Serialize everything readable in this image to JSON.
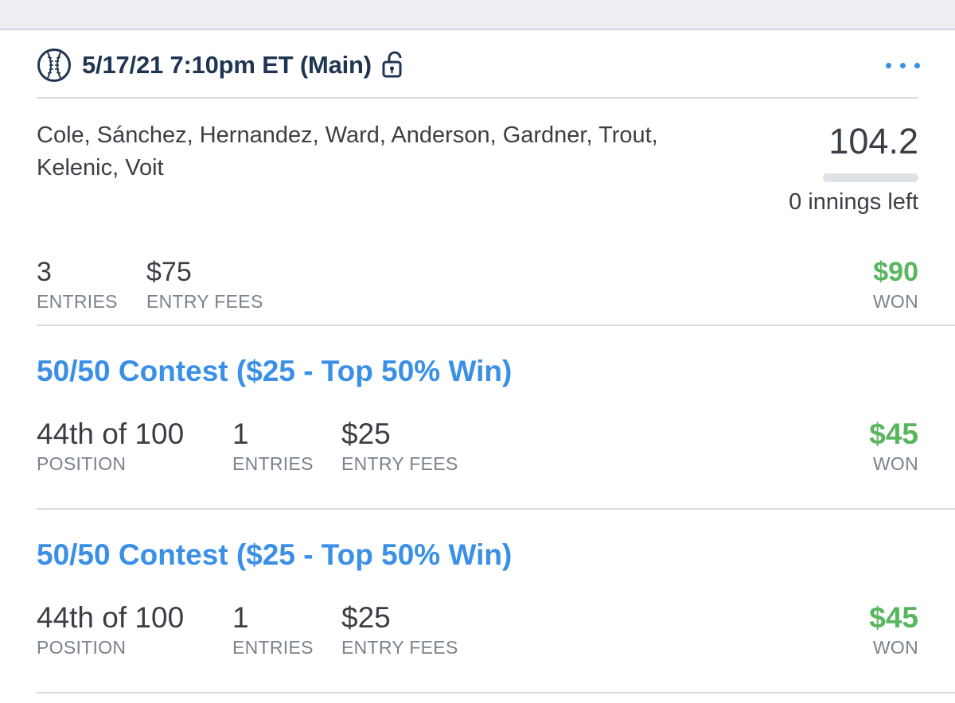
{
  "header": {
    "title": "5/17/21 7:10pm ET (Main)",
    "sport_icon": "baseball-icon",
    "lock_icon": "unlocked-icon",
    "more_icon": "more-horizontal-icon"
  },
  "lineup": {
    "players": "Cole, Sánchez, Hernandez, Ward, Anderson, Gardner, Trout, Kelenic, Voit",
    "score": "104.2",
    "progress_fraction": 0,
    "time_left": "0 innings left"
  },
  "summary": {
    "entries_value": "3",
    "entries_label": "ENTRIES",
    "fees_value": "$75",
    "fees_label": "ENTRY FEES",
    "won_value": "$90",
    "won_label": "WON"
  },
  "contests": [
    {
      "title": "50/50 Contest ($25 - Top 50% Win)",
      "position_value": "44th of 100",
      "position_label": "POSITION",
      "entries_value": "1",
      "entries_label": "ENTRIES",
      "fees_value": "$25",
      "fees_label": "ENTRY FEES",
      "won_value": "$45",
      "won_label": "WON"
    },
    {
      "title": "50/50 Contest ($25 - Top 50% Win)",
      "position_value": "44th of 100",
      "position_label": "POSITION",
      "entries_value": "1",
      "entries_label": "ENTRIES",
      "fees_value": "$25",
      "fees_label": "ENTRY FEES",
      "won_value": "$45",
      "won_label": "WON"
    }
  ],
  "colors": {
    "accent_blue": "#3a8fe6",
    "won_green": "#58b65f",
    "title_navy": "#1f3552"
  }
}
